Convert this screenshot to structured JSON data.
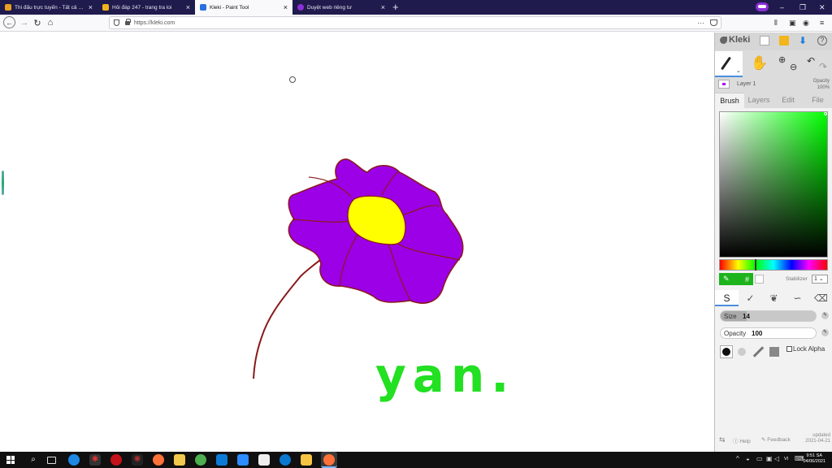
{
  "browser": {
    "tabs": [
      {
        "label": "Thi đấu trực tuyến - Tất cả các",
        "favicon_color": "#e8a020"
      },
      {
        "label": "Hỏi đáp 247 - trang tra loi",
        "favicon_color": "#f2b21b"
      },
      {
        "label": "Kleki - Paint Tool",
        "favicon_color": "#2a6fdb",
        "active": true
      },
      {
        "label": "Duyệt web riêng tư",
        "favicon_color": "#8c2fd6"
      }
    ],
    "tab_close_glyph": "×",
    "new_tab_glyph": "+",
    "url": "https://kleki.com",
    "url_dots": "···",
    "window_controls": [
      "–",
      "❐",
      "✕"
    ]
  },
  "kleki": {
    "logo": "Kleki",
    "layer_name": "Layer 1",
    "opacity_label": "Opacity",
    "opacity_value": "100%",
    "tabs": [
      "Brush",
      "Layers",
      "Edit",
      "File"
    ],
    "active_tab": "Brush",
    "primary_color": "#1db31d",
    "secondary_color": "#ffffff",
    "hex_symbol": "#",
    "stabilizer_label": "Stabilizer",
    "stabilizer_value": "1",
    "brush_size_label": "Size",
    "brush_size_value": "14",
    "brush_size_fraction": 0.27,
    "brush_opacity_label": "Opacity",
    "brush_opacity_value": "100",
    "lock_alpha_label": "Lock Alpha",
    "help_label": "Help",
    "feedback_label": "Feedback",
    "updated_label": "updated",
    "updated_date": "2021-04-21"
  },
  "drawing": {
    "text": "yan.",
    "text_color": "#22e022",
    "petal_color": "#9b00e6",
    "center_color": "#ffff00",
    "outline_color": "#8a1a1a"
  },
  "taskbar": {
    "lang": "VI",
    "time": "9:51 SA",
    "date": "04/06/2021"
  }
}
